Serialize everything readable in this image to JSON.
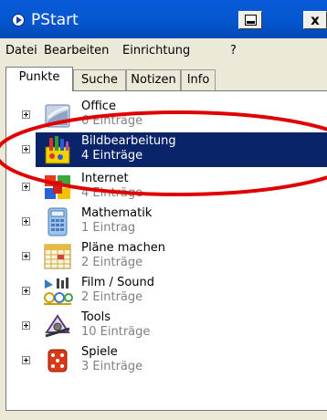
{
  "window": {
    "title": "PStart"
  },
  "titlebar": {
    "print_icon": "printer-icon",
    "close_label": "x"
  },
  "menu": [
    "Datei",
    "Bearbeiten",
    "Einrichtung",
    "?"
  ],
  "tabs": [
    "Punkte",
    "Suche",
    "Notizen",
    "Info"
  ],
  "active_tab": "Punkte",
  "items": [
    {
      "name": "Office",
      "count": "6 Einträge",
      "icon": "office-icon"
    },
    {
      "name": "Bildbearbeitung",
      "count": "4 Einträge",
      "icon": "image-editing-icon",
      "selected": true
    },
    {
      "name": "Internet",
      "count": "4 Einträge",
      "icon": "internet-icon"
    },
    {
      "name": "Mathematik",
      "count": "1 Eintrag",
      "icon": "calculator-icon"
    },
    {
      "name": "Pläne machen",
      "count": "2 Einträge",
      "icon": "calendar-icon"
    },
    {
      "name": "Film / Sound",
      "count": "2 Einträge",
      "icon": "media-icon"
    },
    {
      "name": "Tools",
      "count": "10 Einträge",
      "icon": "tools-icon"
    },
    {
      "name": "Spiele",
      "count": "3 Einträge",
      "icon": "dice-icon"
    }
  ],
  "colors": {
    "selection": "#0a246a",
    "titlebar": "#0456cf",
    "annotation": "#e00000"
  }
}
